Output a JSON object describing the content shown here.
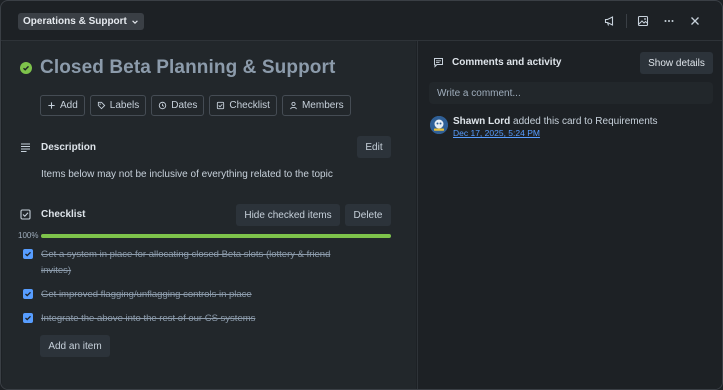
{
  "header": {
    "board_name": "Operations & Support"
  },
  "card": {
    "title": "Closed Beta Planning & Support",
    "actions": [
      "Add",
      "Labels",
      "Dates",
      "Checklist",
      "Members"
    ]
  },
  "description": {
    "heading": "Description",
    "edit_label": "Edit",
    "text": "Items below may not be inclusive of everything related to the topic"
  },
  "checklist": {
    "heading": "Checklist",
    "hide_checked_label": "Hide checked items",
    "delete_label": "Delete",
    "progress_label": "100%",
    "progress": 1.0,
    "items": [
      {
        "text": "Get a system in place for allocating closed Beta slots (lottery & friend invites)",
        "checked": true
      },
      {
        "text": "Get improved flagging/unflagging controls in place",
        "checked": true
      },
      {
        "text": "Integrate the above into the rest of our CS systems",
        "checked": true
      }
    ],
    "add_item_label": "Add an item"
  },
  "activity": {
    "heading": "Comments and activity",
    "show_details_label": "Show details",
    "comment_placeholder": "Write a comment...",
    "entries": [
      {
        "user": "Shawn Lord",
        "action": " added this card to Requirements",
        "time": "Dec 17, 2025, 5:24 PM"
      }
    ]
  },
  "colors": {
    "accent_green": "#7ec34b",
    "checkbox_blue": "#579dff",
    "link_blue": "#579dff"
  }
}
